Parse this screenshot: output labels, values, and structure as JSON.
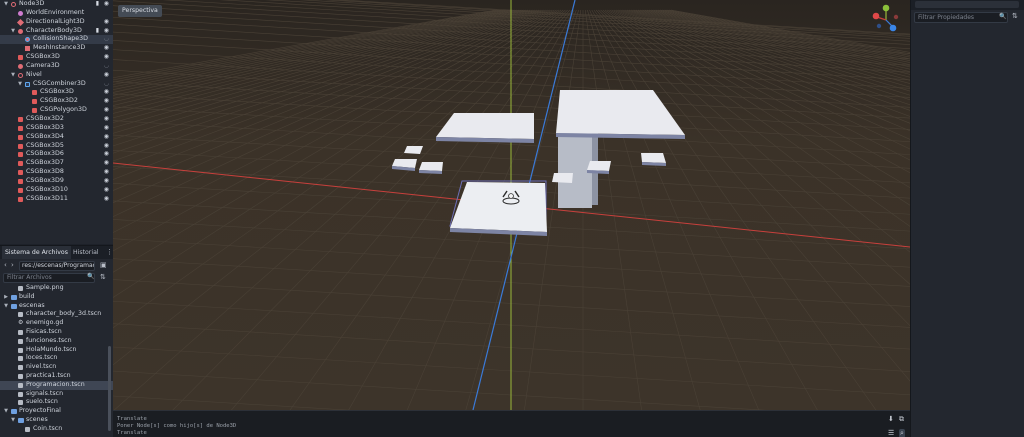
{
  "scene_tree": {
    "nodes": [
      {
        "label": "Node3D",
        "depth": 0,
        "arrow": "open",
        "icon": "ico-node",
        "visible": true,
        "script": true
      },
      {
        "label": "WorldEnvironment",
        "depth": 1,
        "arrow": "",
        "icon": "ico-world",
        "visible": null,
        "script": false
      },
      {
        "label": "DirectionalLight3D",
        "depth": 1,
        "arrow": "",
        "icon": "ico-light",
        "visible": true,
        "script": false
      },
      {
        "label": "CharacterBody3D",
        "depth": 1,
        "arrow": "open",
        "icon": "ico-body",
        "visible": true,
        "script": true
      },
      {
        "label": "CollisionShape3D",
        "depth": 2,
        "arrow": "",
        "icon": "ico-shape",
        "visible": false,
        "script": false,
        "selected": true
      },
      {
        "label": "MeshInstance3D",
        "depth": 2,
        "arrow": "",
        "icon": "ico-mesh",
        "visible": true,
        "script": false
      },
      {
        "label": "CSGBox3D",
        "depth": 1,
        "arrow": "",
        "icon": "ico-csg",
        "visible": true,
        "script": false
      },
      {
        "label": "Camera3D",
        "depth": 1,
        "arrow": "",
        "icon": "ico-cam",
        "visible": false,
        "script": false
      },
      {
        "label": "Nivel",
        "depth": 1,
        "arrow": "open",
        "icon": "ico-node",
        "visible": true,
        "script": false
      },
      {
        "label": "CSGCombiner3D",
        "depth": 2,
        "arrow": "open",
        "icon": "ico-combiner",
        "visible": false,
        "script": false
      },
      {
        "label": "CSGBox3D",
        "depth": 3,
        "arrow": "",
        "icon": "ico-csg",
        "visible": true,
        "script": false
      },
      {
        "label": "CSGBox3D2",
        "depth": 3,
        "arrow": "",
        "icon": "ico-csg",
        "visible": true,
        "script": false
      },
      {
        "label": "CSGPolygon3D",
        "depth": 3,
        "arrow": "",
        "icon": "ico-csg",
        "visible": true,
        "script": false
      },
      {
        "label": "CSGBox3D2",
        "depth": 1,
        "arrow": "",
        "icon": "ico-csg",
        "visible": true,
        "script": false
      },
      {
        "label": "CSGBox3D3",
        "depth": 1,
        "arrow": "",
        "icon": "ico-csg",
        "visible": true,
        "script": false
      },
      {
        "label": "CSGBox3D4",
        "depth": 1,
        "arrow": "",
        "icon": "ico-csg",
        "visible": true,
        "script": false
      },
      {
        "label": "CSGBox3D5",
        "depth": 1,
        "arrow": "",
        "icon": "ico-csg",
        "visible": true,
        "script": false
      },
      {
        "label": "CSGBox3D6",
        "depth": 1,
        "arrow": "",
        "icon": "ico-csg",
        "visible": true,
        "script": false
      },
      {
        "label": "CSGBox3D7",
        "depth": 1,
        "arrow": "",
        "icon": "ico-csg",
        "visible": true,
        "script": false
      },
      {
        "label": "CSGBox3D8",
        "depth": 1,
        "arrow": "",
        "icon": "ico-csg",
        "visible": true,
        "script": false
      },
      {
        "label": "CSGBox3D9",
        "depth": 1,
        "arrow": "",
        "icon": "ico-csg",
        "visible": true,
        "script": false
      },
      {
        "label": "CSGBox3D10",
        "depth": 1,
        "arrow": "",
        "icon": "ico-csg",
        "visible": true,
        "script": false
      },
      {
        "label": "CSGBox3D11",
        "depth": 1,
        "arrow": "",
        "icon": "ico-csg",
        "visible": true,
        "script": false
      }
    ]
  },
  "filesystem": {
    "tabs": [
      "Sistema de Archivos",
      "Historial"
    ],
    "path": "res://escenas/Programaci",
    "filter_placeholder": "Filtrar Archivos",
    "items": [
      {
        "label": "Sample.png",
        "depth": 2,
        "kind": "file",
        "arrow": ""
      },
      {
        "label": "build",
        "depth": 1,
        "kind": "folder",
        "arrow": "closed"
      },
      {
        "label": "escenas",
        "depth": 1,
        "kind": "folder",
        "arrow": "open"
      },
      {
        "label": "character_body_3d.tscn",
        "depth": 2,
        "kind": "file",
        "arrow": ""
      },
      {
        "label": "enemigo.gd",
        "depth": 2,
        "kind": "gear",
        "arrow": ""
      },
      {
        "label": "Fisicas.tscn",
        "depth": 2,
        "kind": "file",
        "arrow": ""
      },
      {
        "label": "funciones.tscn",
        "depth": 2,
        "kind": "file",
        "arrow": ""
      },
      {
        "label": "HolaMundo.tscn",
        "depth": 2,
        "kind": "file",
        "arrow": ""
      },
      {
        "label": "loces.tscn",
        "depth": 2,
        "kind": "file",
        "arrow": ""
      },
      {
        "label": "nivel.tscn",
        "depth": 2,
        "kind": "file",
        "arrow": ""
      },
      {
        "label": "practica1.tscn",
        "depth": 2,
        "kind": "file",
        "arrow": ""
      },
      {
        "label": "Programacion.tscn",
        "depth": 2,
        "kind": "file",
        "arrow": "",
        "selected": true
      },
      {
        "label": "signals.tscn",
        "depth": 2,
        "kind": "file",
        "arrow": ""
      },
      {
        "label": "suelo.tscn",
        "depth": 2,
        "kind": "file",
        "arrow": ""
      },
      {
        "label": "ProyectoFinal",
        "depth": 1,
        "kind": "folder",
        "arrow": "open"
      },
      {
        "label": "scenes",
        "depth": 2,
        "kind": "folder",
        "arrow": "open"
      },
      {
        "label": "Coin.tscn",
        "depth": 3,
        "kind": "file",
        "arrow": ""
      }
    ]
  },
  "viewport": {
    "mode_label": "Perspectiva",
    "colors": {
      "floor": "#3b3228",
      "grid": "#4a4136",
      "x_axis": "#c8403c",
      "y_axis": "#9ab83a",
      "z_axis": "#3a7ad8",
      "platform": "#e8e9ee",
      "platform_edge": "#8a90a8"
    }
  },
  "output": {
    "lines": [
      "Translate",
      "Poner Node[s] como hijo[s] de Node3D",
      "Translate"
    ]
  },
  "inspector": {
    "filter_placeholder": "Filtrar Propiedades"
  }
}
